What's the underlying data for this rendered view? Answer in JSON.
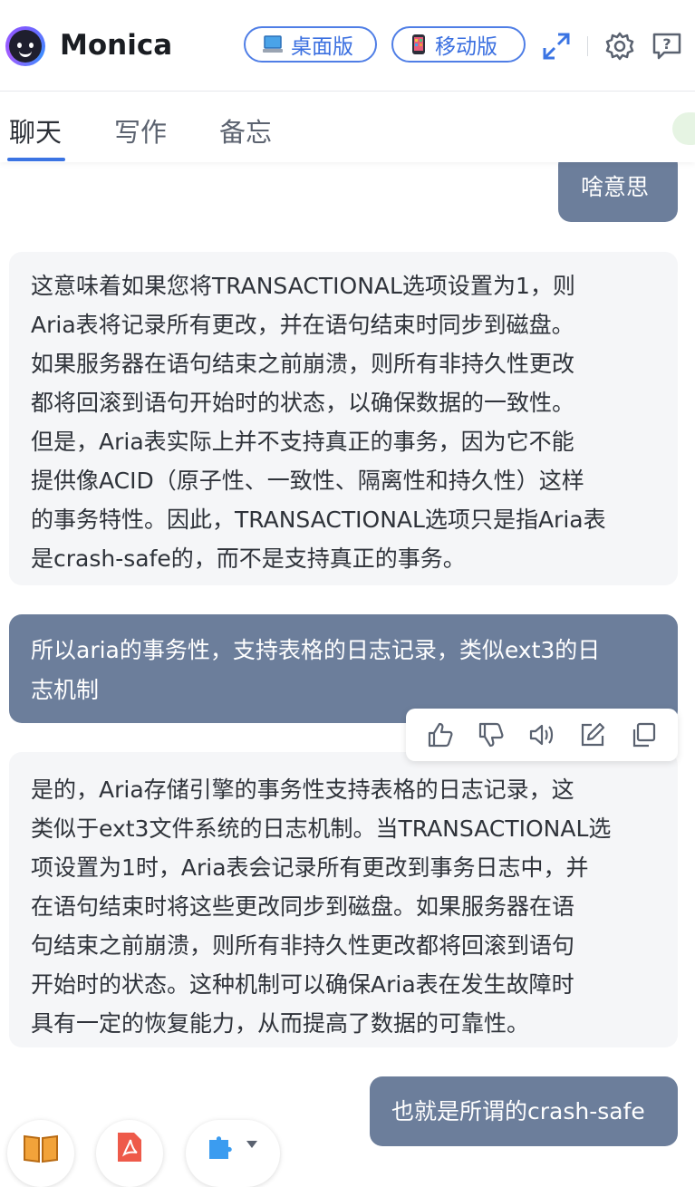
{
  "app": {
    "title": "Monica"
  },
  "header": {
    "desktop_label": "桌面版",
    "mobile_label": "移动版"
  },
  "tabs": [
    {
      "label": "聊天",
      "active": true
    },
    {
      "label": "写作",
      "active": false
    },
    {
      "label": "备忘",
      "active": false
    }
  ],
  "messages": [
    {
      "role": "user",
      "text": "啥意思"
    },
    {
      "role": "ai",
      "lines": [
        "这意味着如果您将TRANSACTIONAL选项设置为1，则",
        "Aria表将记录所有更改，并在语句结束时同步到磁盘。",
        "如果服务器在语句结束之前崩溃，则所有非持久性更改",
        "都将回滚到语句开始时的状态，以确保数据的一致性。",
        "但是，Aria表实际上并不支持真正的事务，因为它不能",
        "提供像ACID（原子性、一致性、隔离性和持久性）这样",
        "的事务特性。因此，TRANSACTIONAL选项只是指Aria表",
        "是crash-safe的，而不是支持真正的事务。"
      ]
    },
    {
      "role": "user",
      "lines": [
        "所以aria的事务性，支持表格的日志记录，类似ext3的日",
        "志机制"
      ]
    },
    {
      "role": "ai",
      "lines": [
        "是的，Aria存储引擎的事务性支持表格的日志记录，这",
        "类似于ext3文件系统的日志机制。当TRANSACTIONAL选",
        "项设置为1时，Aria表会记录所有更改到事务日志中，并",
        "在语句结束时将这些更改同步到磁盘。如果服务器在语",
        "句结束之前崩溃，则所有非持久性更改都将回滚到语句",
        "开始时的状态。这种机制可以确保Aria表在发生故障时",
        "具有一定的恢复能力，从而提高了数据的可靠性。"
      ]
    },
    {
      "role": "user",
      "text": "也就是所谓的crash-safe"
    }
  ],
  "message_actions": [
    "thumbs-up-icon",
    "thumbs-down-icon",
    "speaker-icon",
    "edit-icon",
    "copy-icon"
  ],
  "tools": [
    "book-icon",
    "pdf-icon",
    "plugin-icon"
  ],
  "colors": {
    "accent": "#3b74e3",
    "user_bubble": "#6c7e9b",
    "ai_bubble": "#f5f6f8"
  }
}
